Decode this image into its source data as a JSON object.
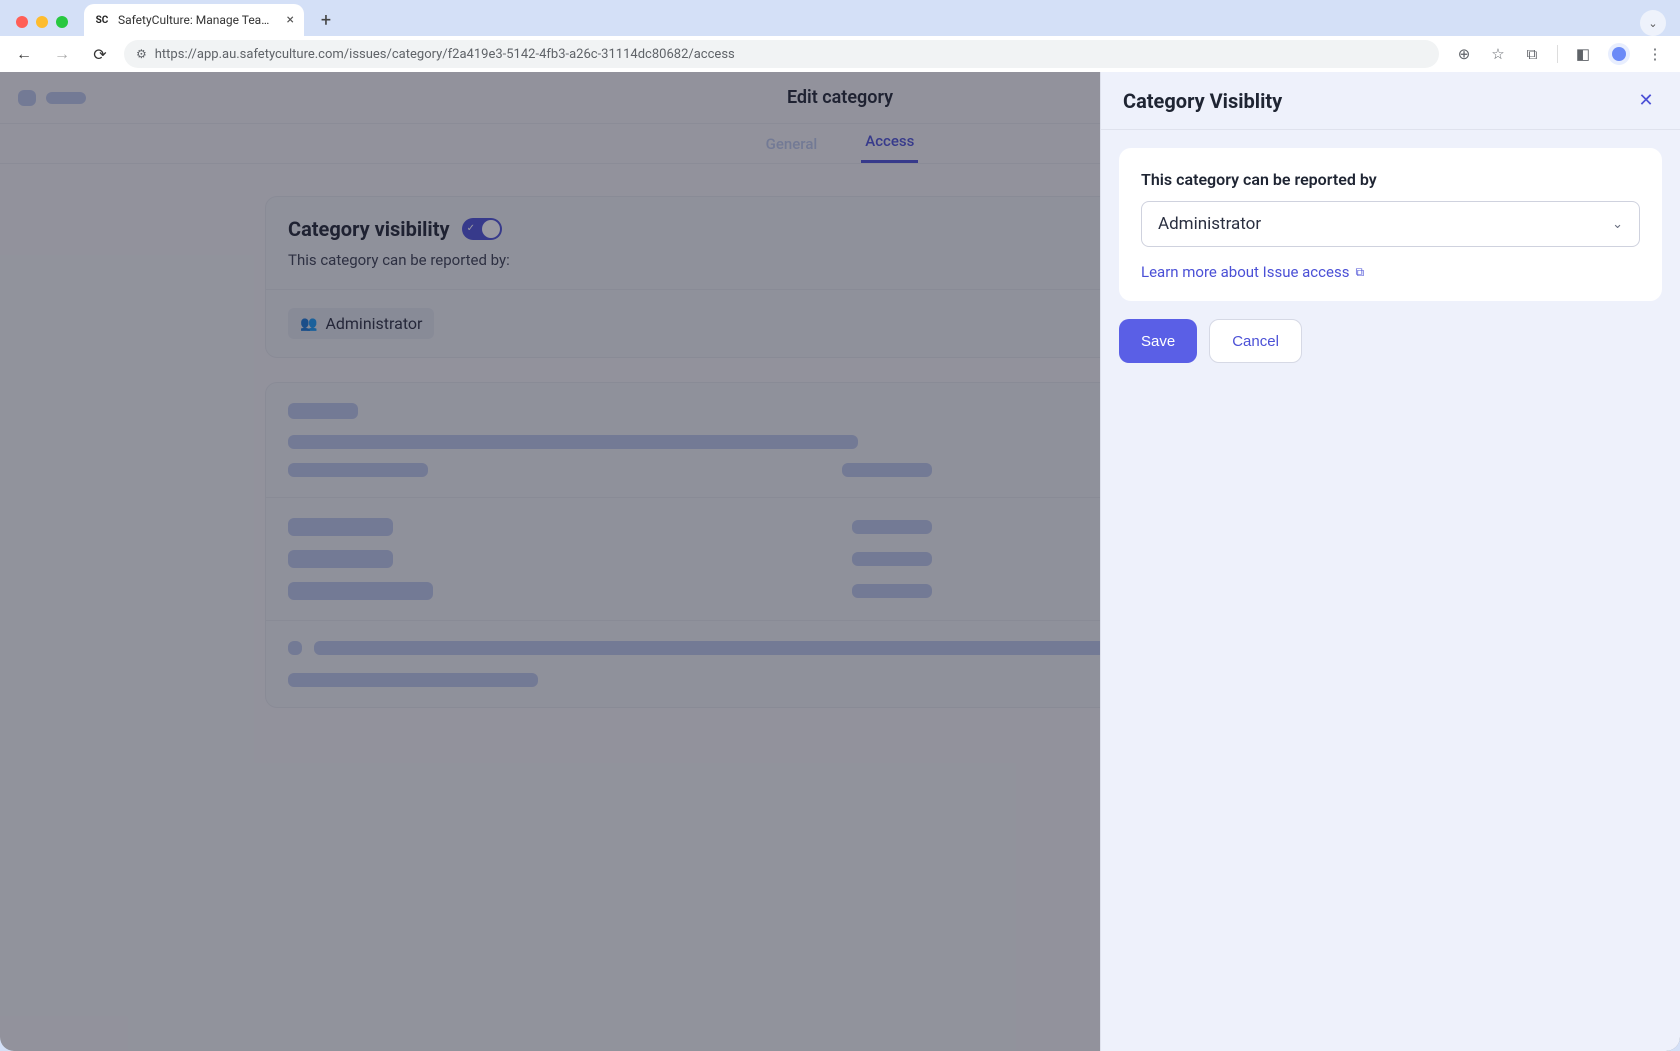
{
  "browser": {
    "tab_title": "SafetyCulture: Manage Teams and...",
    "url": "https://app.au.safetyculture.com/issues/category/f2a419e3-5142-4fb3-a26c-31114dc80682/access"
  },
  "header": {
    "title": "Edit category"
  },
  "tabs": {
    "general": "General",
    "access": "Access"
  },
  "visibility_card": {
    "title": "Category visibility",
    "subtitle": "This category can be reported by:",
    "chip_label": "Administrator"
  },
  "panel": {
    "title": "Category Visiblity",
    "field_label": "This category can be reported by",
    "select_value": "Administrator",
    "learn_more": "Learn more about Issue access",
    "save": "Save",
    "cancel": "Cancel"
  }
}
